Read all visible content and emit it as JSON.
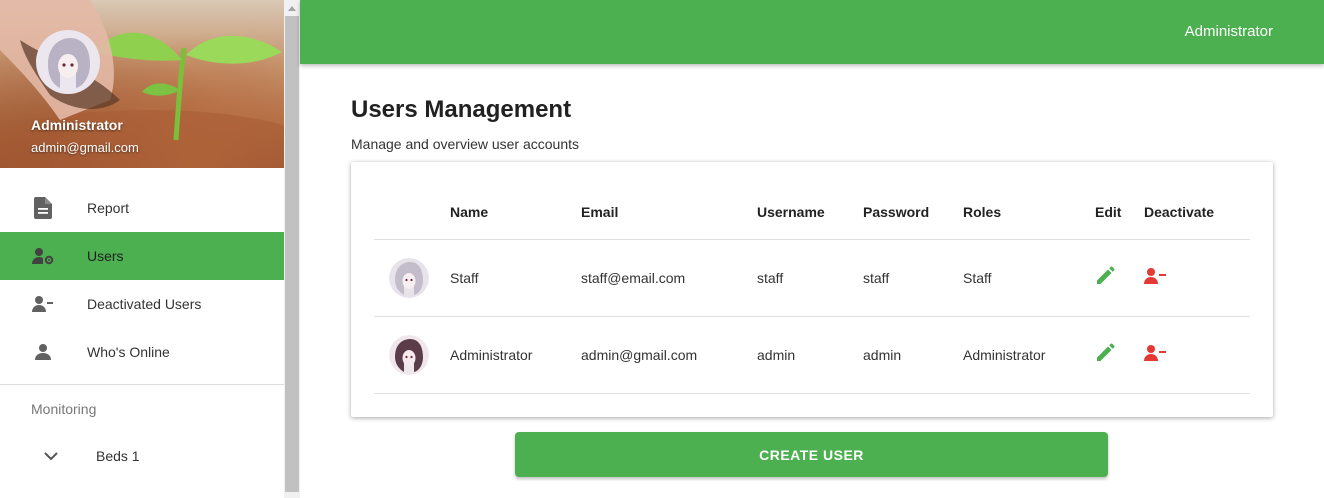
{
  "colors": {
    "primary": "#4caf50",
    "danger": "#e53935",
    "icon": "#616161"
  },
  "sidebar": {
    "profile": {
      "name": "Administrator",
      "email": "admin@gmail.com"
    },
    "items": [
      {
        "label": "Report",
        "icon": "description-icon",
        "active": false
      },
      {
        "label": "Users",
        "icon": "manage-accounts-icon",
        "active": true
      },
      {
        "label": "Deactivated Users",
        "icon": "person-remove-icon",
        "active": false
      },
      {
        "label": "Who's Online",
        "icon": "person-icon",
        "active": false
      }
    ],
    "section_label": "Monitoring",
    "sub_items": [
      {
        "label": "Beds 1",
        "icon": "chevron-down-icon"
      }
    ]
  },
  "header": {
    "user": "Administrator"
  },
  "main": {
    "title": "Users Management",
    "subtitle": "Manage and overview user accounts"
  },
  "table": {
    "columns": [
      "",
      "Name",
      "Email",
      "Username",
      "Password",
      "Roles",
      "Edit",
      "Deactivate"
    ],
    "rows": [
      {
        "name": "Staff",
        "email": "staff@email.com",
        "username": "staff",
        "password": "staff",
        "role": "Staff"
      },
      {
        "name": "Administrator",
        "email": "admin@gmail.com",
        "username": "admin",
        "password": "admin",
        "role": "Administrator"
      }
    ]
  },
  "actions": {
    "create_user": "CREATE USER"
  }
}
